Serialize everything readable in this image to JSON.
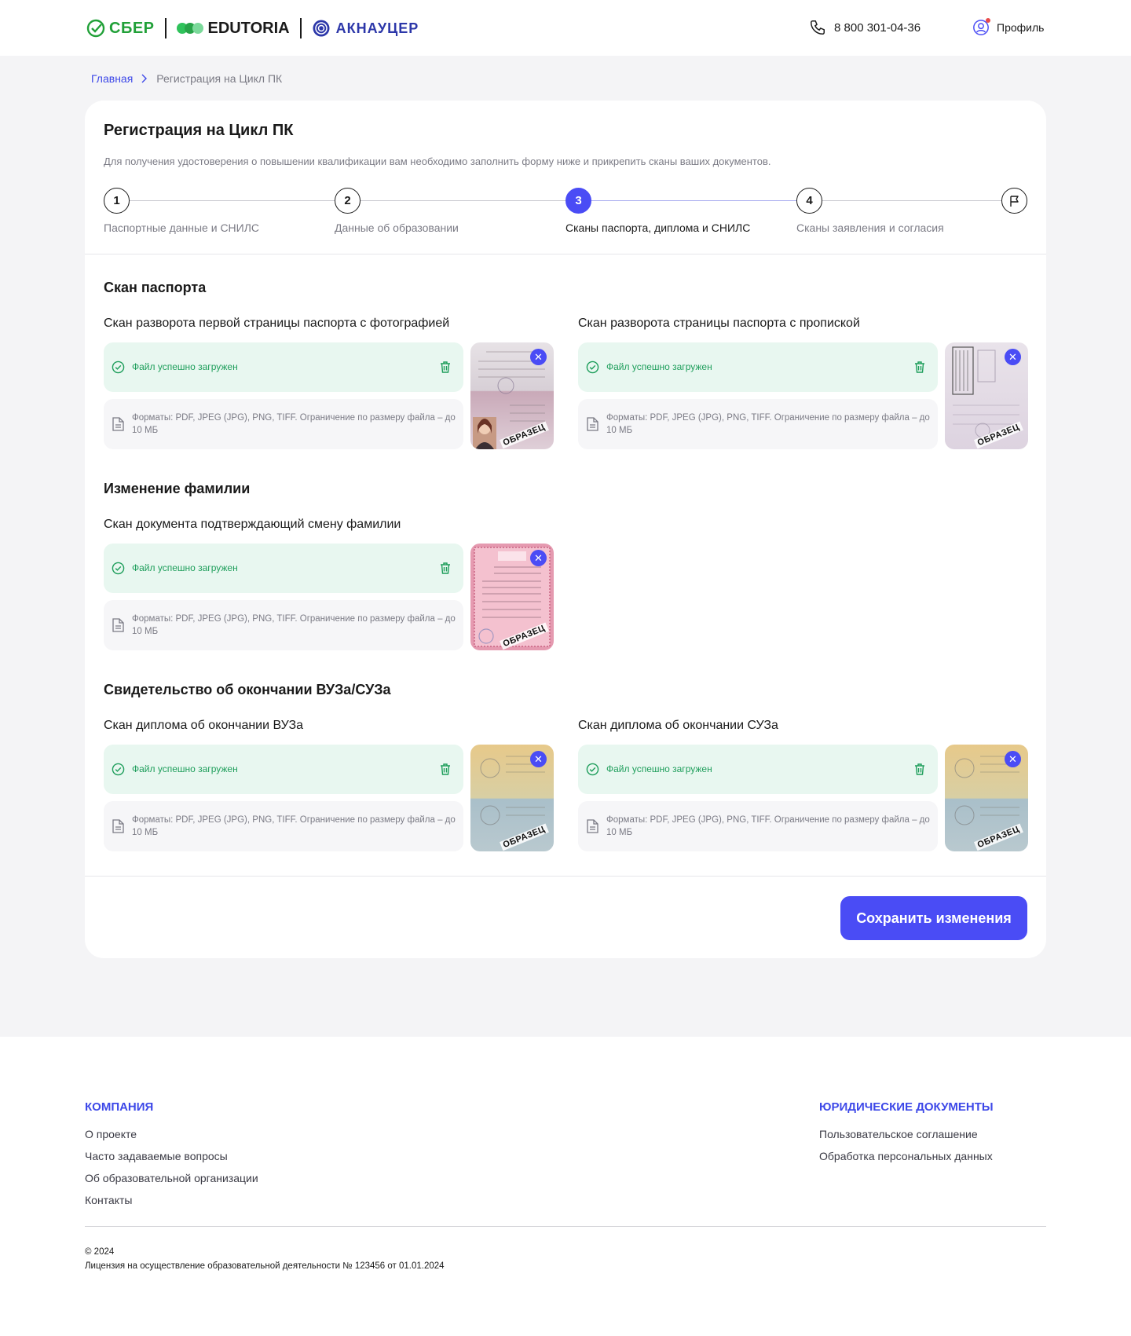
{
  "header": {
    "brand_sber": "СБЕР",
    "brand_edutoria": "EDUTORIA",
    "brand_aknaucer": "АКНАУЦЕР",
    "phone": "8 800 301-04-36",
    "profile": "Профиль"
  },
  "breadcrumb": {
    "home": "Главная",
    "current": "Регистрация на Цикл ПК"
  },
  "card": {
    "title": "Регистрация на Цикл ПК",
    "description": "Для получения удостоверения о повышении квалификации вам необходимо заполнить форму ниже и прикрепить сканы ваших документов."
  },
  "steps": [
    {
      "number": "1",
      "label": "Паспортные данные и СНИЛС"
    },
    {
      "number": "2",
      "label": "Данные об образовании"
    },
    {
      "number": "3",
      "label": "Сканы паспорта, диплома и СНИЛС",
      "active": true
    },
    {
      "number": "4",
      "label": "Сканы заявления и согласия"
    },
    {
      "number": "",
      "label": "",
      "icon": "flag-icon"
    }
  ],
  "sections": {
    "passport": {
      "title": "Скан паспорта",
      "field1": "Скан разворота первой страницы паспорта с фотографией",
      "field2": "Скан разворота страницы паспорта с пропиской"
    },
    "surname": {
      "title": "Изменение фамилии",
      "field1": "Скан документа подтверждающий смену фамилии"
    },
    "education": {
      "title": "Свидетельство об окончании ВУЗа/СУЗа",
      "field1": "Скан диплома об окончании ВУЗа",
      "field2": "Скан диплома об окончании СУЗа"
    }
  },
  "upload": {
    "success": "Файл успешно загружен",
    "formats": "Форматы: PDF, JPEG (JPG), PNG, TIFF. Ограничение по размеру файла – до 10 МБ",
    "stamp": "ОБРАЗЕЦ",
    "close": "✕"
  },
  "save_button": "Сохранить изменения",
  "footer": {
    "company_title": "КОМПАНИЯ",
    "company_links": [
      "О проекте",
      "Часто задаваемые вопросы",
      "Об образовательной организации",
      "Контакты"
    ],
    "legal_title": "ЮРИДИЧЕСКИЕ ДОКУМЕНТЫ",
    "legal_links": [
      "Пользовательское соглашение",
      "Обработка персональных данных"
    ],
    "copyright": "© 2024",
    "license": "Лицензия на осуществление образовательной деятельности № 123456 от 01.01.2024"
  },
  "colors": {
    "accent": "#4a4cf5",
    "success": "#1e9e5b",
    "success_bg": "#e8f7f0",
    "link": "#3d48e8"
  }
}
